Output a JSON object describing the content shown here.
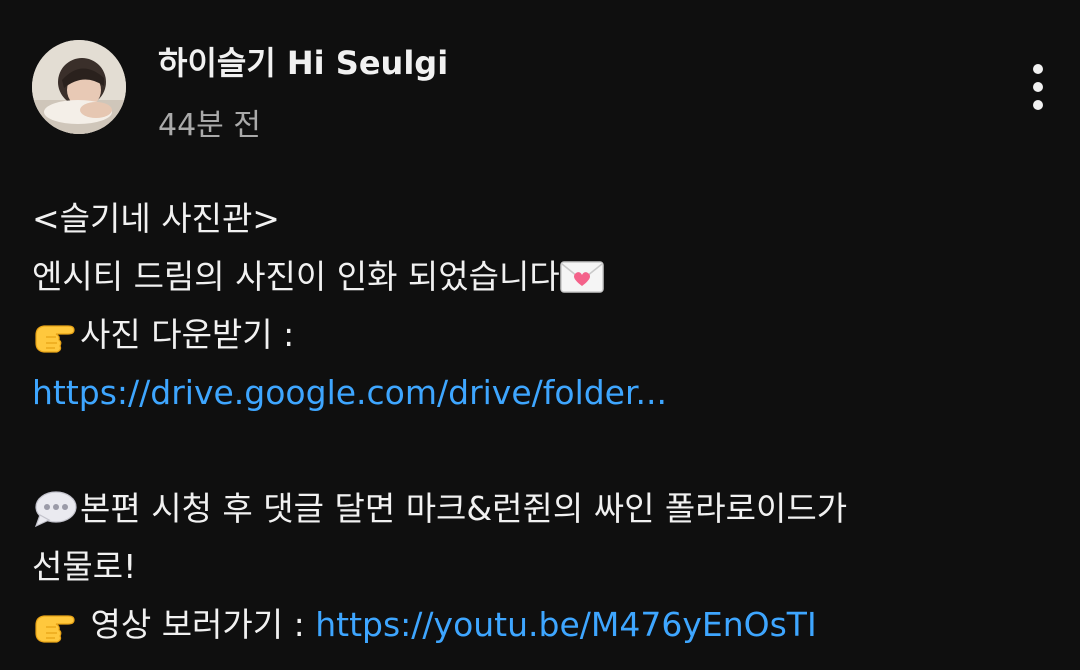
{
  "channel": {
    "name": "하이슬기 Hi Seulgi",
    "time": "44분 전"
  },
  "post": {
    "line1": "<슬기네 사진관>",
    "line2": "엔시티 드림의 사진이 인화 되었습니다",
    "line3": "사진 다운받기 :",
    "line4_link": "https://drive.google.com/drive/folder...",
    "line6": "본편 시청 후 댓글 달면 마크&런쥔의 싸인 폴라로이드가",
    "line7": "선물로!",
    "line8_text": " 영상 보러가기 : ",
    "line8_link": "https://youtu.be/M476yEnOsTI"
  },
  "icons": {
    "avatar": "profile-photo",
    "menu": "more-vert-icon",
    "love_letter": "love-letter-emoji-icon",
    "pointing": "pointing-right-emoji-icon",
    "speech": "speech-balloon-emoji-icon"
  },
  "colors": {
    "background": "#0f0f0f",
    "text": "#f1f1f1",
    "secondary_text": "#aaaaaa",
    "link": "#3ea6ff"
  }
}
